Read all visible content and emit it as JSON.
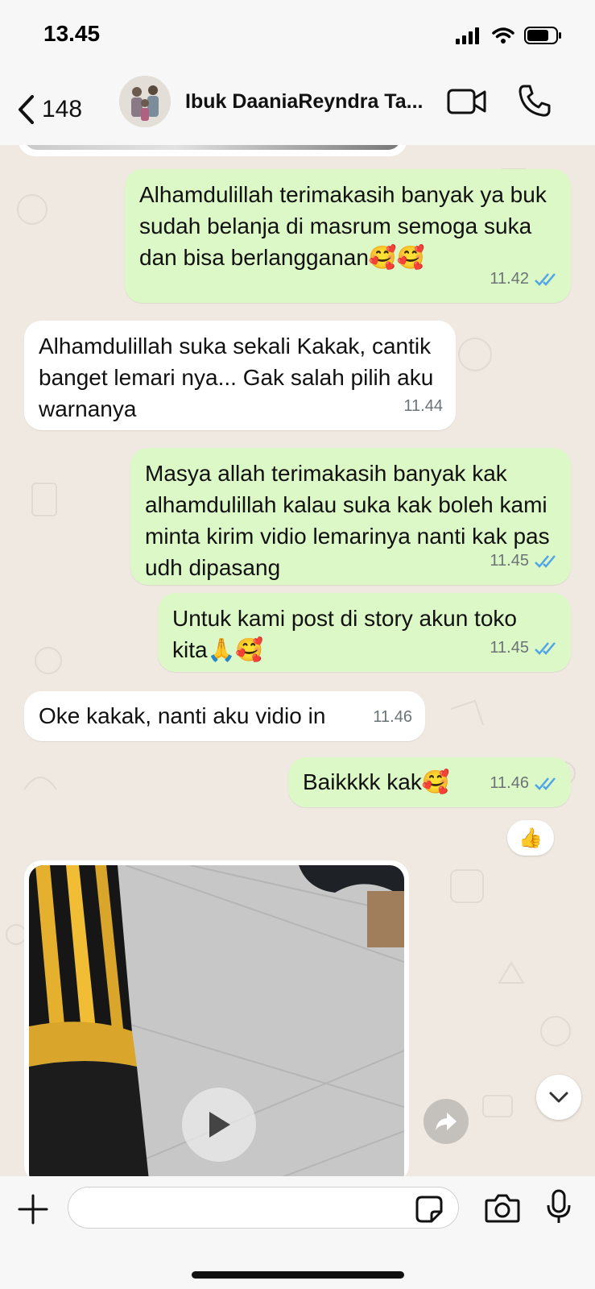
{
  "status_bar": {
    "time": "13.45"
  },
  "header": {
    "back_count": "148",
    "contact_name": "Ibuk DaaniaReyndra Ta..."
  },
  "messages": [
    {
      "direction": "out",
      "text": "Alhamdulillah terimakasih banyak ya buk sudah belanja di masrum semoga suka dan bisa berlangganan🥰🥰",
      "time": "11.42",
      "status": "read"
    },
    {
      "direction": "in",
      "text": "Alhamdulillah suka sekali Kakak, cantik banget lemari nya... Gak salah pilih aku warnanya",
      "time": "11.44"
    },
    {
      "direction": "out",
      "text": "Masya allah terimakasih banyak kak alhamdulillah kalau suka kak boleh kami minta kirim vidio lemarinya nanti kak pas udh dipasang",
      "time": "11.45",
      "status": "read"
    },
    {
      "direction": "out",
      "text": "Untuk kami post di story akun toko kita🙏🥰",
      "time": "11.45",
      "status": "read"
    },
    {
      "direction": "in",
      "text": "Oke kakak, nanti aku vidio in",
      "time": "11.46"
    },
    {
      "direction": "out",
      "text": "Baikkkk kak🥰",
      "time": "11.46",
      "status": "read",
      "reaction": "👍"
    }
  ],
  "input": {
    "placeholder": ""
  },
  "colors": {
    "outgoing_bubble": "#dcf8c6",
    "incoming_bubble": "#ffffff",
    "chat_background": "#efe9e1",
    "read_ticks": "#4fa5e8"
  },
  "icons": {
    "back": "chevron-left-icon",
    "video_call": "video-camera-icon",
    "voice_call": "phone-icon",
    "attach": "plus-icon",
    "sticker": "sticker-icon",
    "camera": "camera-icon",
    "mic": "microphone-icon",
    "play": "play-icon",
    "forward": "forward-icon",
    "scroll_down": "chevron-down-icon"
  }
}
